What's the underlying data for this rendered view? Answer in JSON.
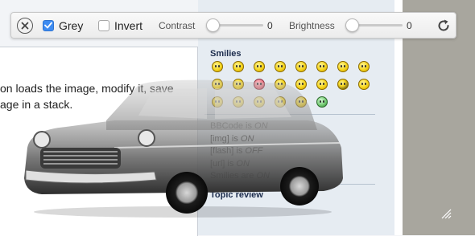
{
  "toolbar": {
    "grey_label": "Grey",
    "grey_checked": true,
    "invert_label": "Invert",
    "invert_checked": false,
    "contrast_label": "Contrast",
    "contrast_value": "0",
    "brightness_label": "Brightness",
    "brightness_value": "0"
  },
  "page": {
    "intro_line_1": "on loads the image, modify it, save",
    "intro_line_2": "age in a stack.",
    "smilies_title": "Smilies",
    "status": [
      {
        "prefix": "BBCode is ",
        "state": "ON"
      },
      {
        "prefix": "[img] is ",
        "state": "ON"
      },
      {
        "prefix": "[flash] is ",
        "state": "OFF"
      },
      {
        "prefix": "[url] is ",
        "state": "ON"
      },
      {
        "prefix": "Smilies are ",
        "state": "ON"
      }
    ],
    "topic_review": "Topic review"
  },
  "colors": {
    "accent": "#3d8bf2",
    "header_text": "#1d2d4d",
    "side_gray": "#a8a69e"
  }
}
